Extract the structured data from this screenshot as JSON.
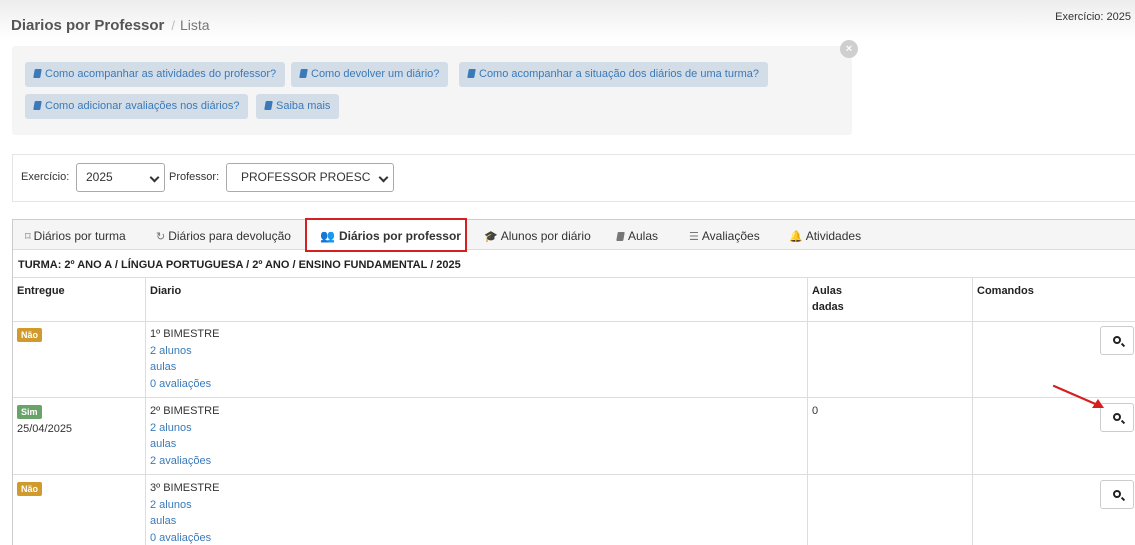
{
  "header": {
    "title": "Diarios por Professor",
    "separator": "/",
    "subtitle": "Lista",
    "exercicio": "Exercício: 2025"
  },
  "help": {
    "close": "×",
    "links": [
      "Como acompanhar as atividades do professor?",
      "Como devolver um diário?",
      "Como acompanhar a situação dos diários de uma turma?",
      "Como adicionar avaliações nos diários?",
      "Saiba mais"
    ]
  },
  "filters": {
    "exercicio_label": "Exercício:",
    "exercicio_value": "2025",
    "professor_label": "Professor:",
    "professor_value": "PROFESSOR PROESC"
  },
  "tabs": [
    {
      "label": "Diários por turma",
      "icon": "bookmark-icon"
    },
    {
      "label": "Diários para devolução",
      "icon": "refresh-icon"
    },
    {
      "label": "Diários por professor",
      "icon": "users-icon"
    },
    {
      "label": "Alunos por diário",
      "icon": "graduation-cap-icon"
    },
    {
      "label": "Aulas",
      "icon": "book-icon"
    },
    {
      "label": "Avaliações",
      "icon": "list-icon"
    },
    {
      "label": "Atividades",
      "icon": "bell-icon"
    }
  ],
  "turma": "TURMA: 2º ANO A / LÍNGUA PORTUGUESA / 2º ANO / ENSINO FUNDAMENTAL / 2025",
  "table": {
    "headers": {
      "entregue": "Entregue",
      "diario": "Diario",
      "aulas_1": "Aulas",
      "aulas_2": "dadas",
      "comandos": "Comandos"
    },
    "rows": [
      {
        "badge": "Não",
        "date": "",
        "bimestre": "1º BIMESTRE",
        "alunos": "2 alunos",
        "aulas": "aulas",
        "avaliacoes": "0 avaliações",
        "aulas_dadas": ""
      },
      {
        "badge": "Sim",
        "date": "25/04/2025",
        "bimestre": "2º BIMESTRE",
        "alunos": "2 alunos",
        "aulas": "aulas",
        "avaliacoes": "2 avaliações",
        "aulas_dadas": "0"
      },
      {
        "badge": "Não",
        "date": "",
        "bimestre": "3º BIMESTRE",
        "alunos": "2 alunos",
        "aulas": "aulas",
        "avaliacoes": "0 avaliações",
        "aulas_dadas": ""
      }
    ]
  },
  "colors": {
    "badge_no": "#d09a2c",
    "badge_yes": "#6aa36a",
    "link": "#3a7ab8",
    "highlight": "#d62020"
  }
}
